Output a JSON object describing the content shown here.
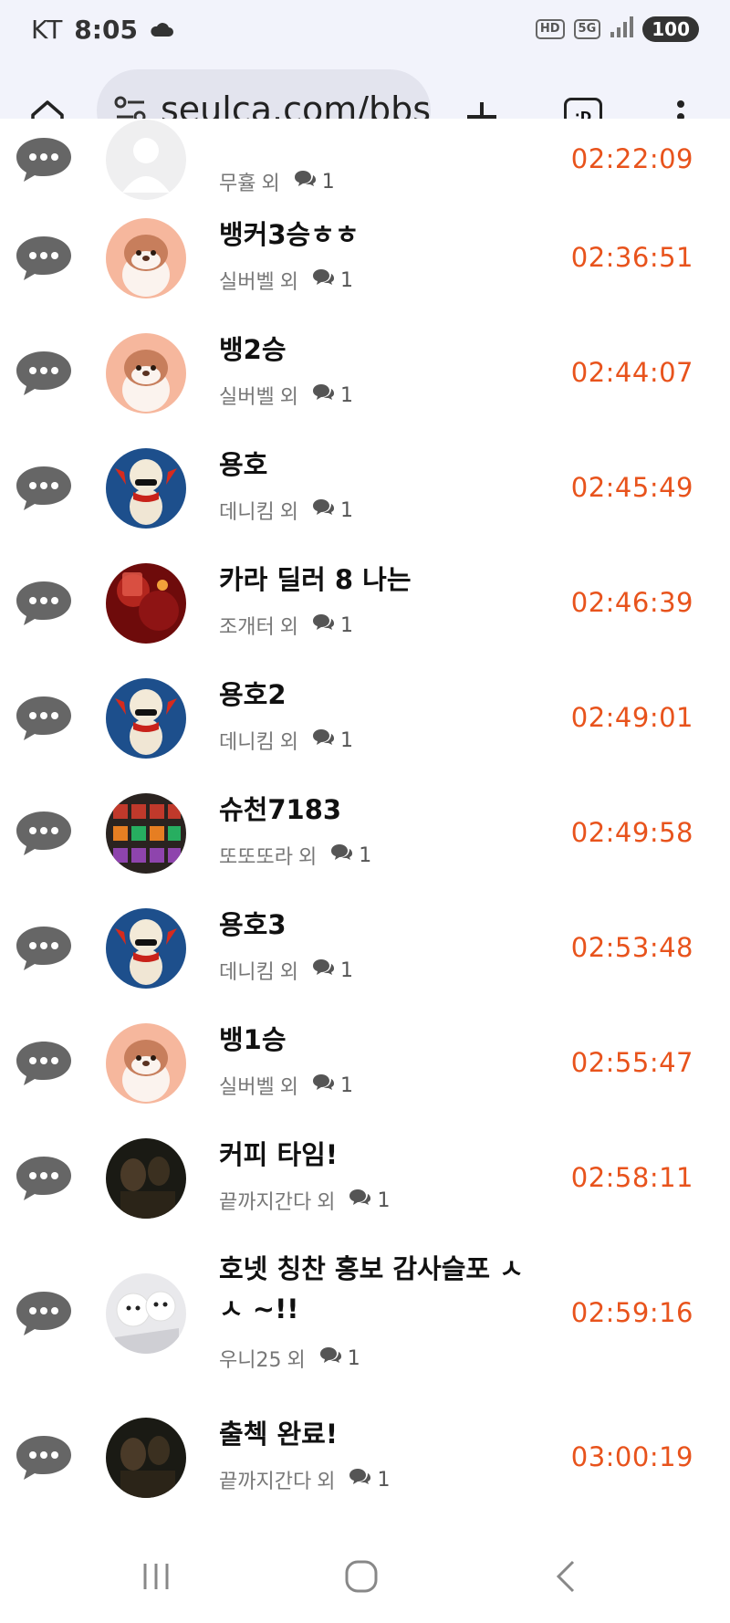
{
  "status_bar": {
    "carrier": "KT",
    "time": "8:05",
    "hd_label": "HD",
    "network_label": "5G",
    "battery": "100"
  },
  "browser": {
    "url": "seulca.com/bbs",
    "tab_switcher_label": ":D"
  },
  "list": {
    "separator": "외",
    "rows": [
      {
        "title": "",
        "author": "무휼",
        "count": "1",
        "time": "02:22:09",
        "avatar": "default"
      },
      {
        "title": "뱅커3승ㅎㅎ",
        "author": "실버벨",
        "count": "1",
        "time": "02:36:51",
        "avatar": "otter"
      },
      {
        "title": "뱅2승",
        "author": "실버벨",
        "count": "1",
        "time": "02:44:07",
        "avatar": "otter"
      },
      {
        "title": "용호",
        "author": "데니킴",
        "count": "1",
        "time": "02:45:49",
        "avatar": "penguin"
      },
      {
        "title": "카라 딜러 8 나는",
        "author": "조개터",
        "count": "1",
        "time": "02:46:39",
        "avatar": "red-drink"
      },
      {
        "title": "용호2",
        "author": "데니킴",
        "count": "1",
        "time": "02:49:01",
        "avatar": "penguin"
      },
      {
        "title": "슈천7183",
        "author": "또또또라",
        "count": "1",
        "time": "02:49:58",
        "avatar": "slot"
      },
      {
        "title": "용호3",
        "author": "데니킴",
        "count": "1",
        "time": "02:53:48",
        "avatar": "penguin"
      },
      {
        "title": "뱅1승",
        "author": "실버벨",
        "count": "1",
        "time": "02:55:47",
        "avatar": "otter"
      },
      {
        "title": "커피 타임!",
        "author": "끝까지간다",
        "count": "1",
        "time": "02:58:11",
        "avatar": "dark-photo"
      },
      {
        "title": "호넷 칭찬 홍보 감사슬포 ㅅㅅ ~!!",
        "author": "우니25",
        "count": "1",
        "time": "02:59:16",
        "avatar": "puppies"
      },
      {
        "title": "출첵 완료!",
        "author": "끝까지간다",
        "count": "1",
        "time": "03:00:19",
        "avatar": "dark-photo"
      }
    ]
  },
  "colors": {
    "time_text": "#e8531c",
    "chrome_bg": "#f2f3fb"
  }
}
